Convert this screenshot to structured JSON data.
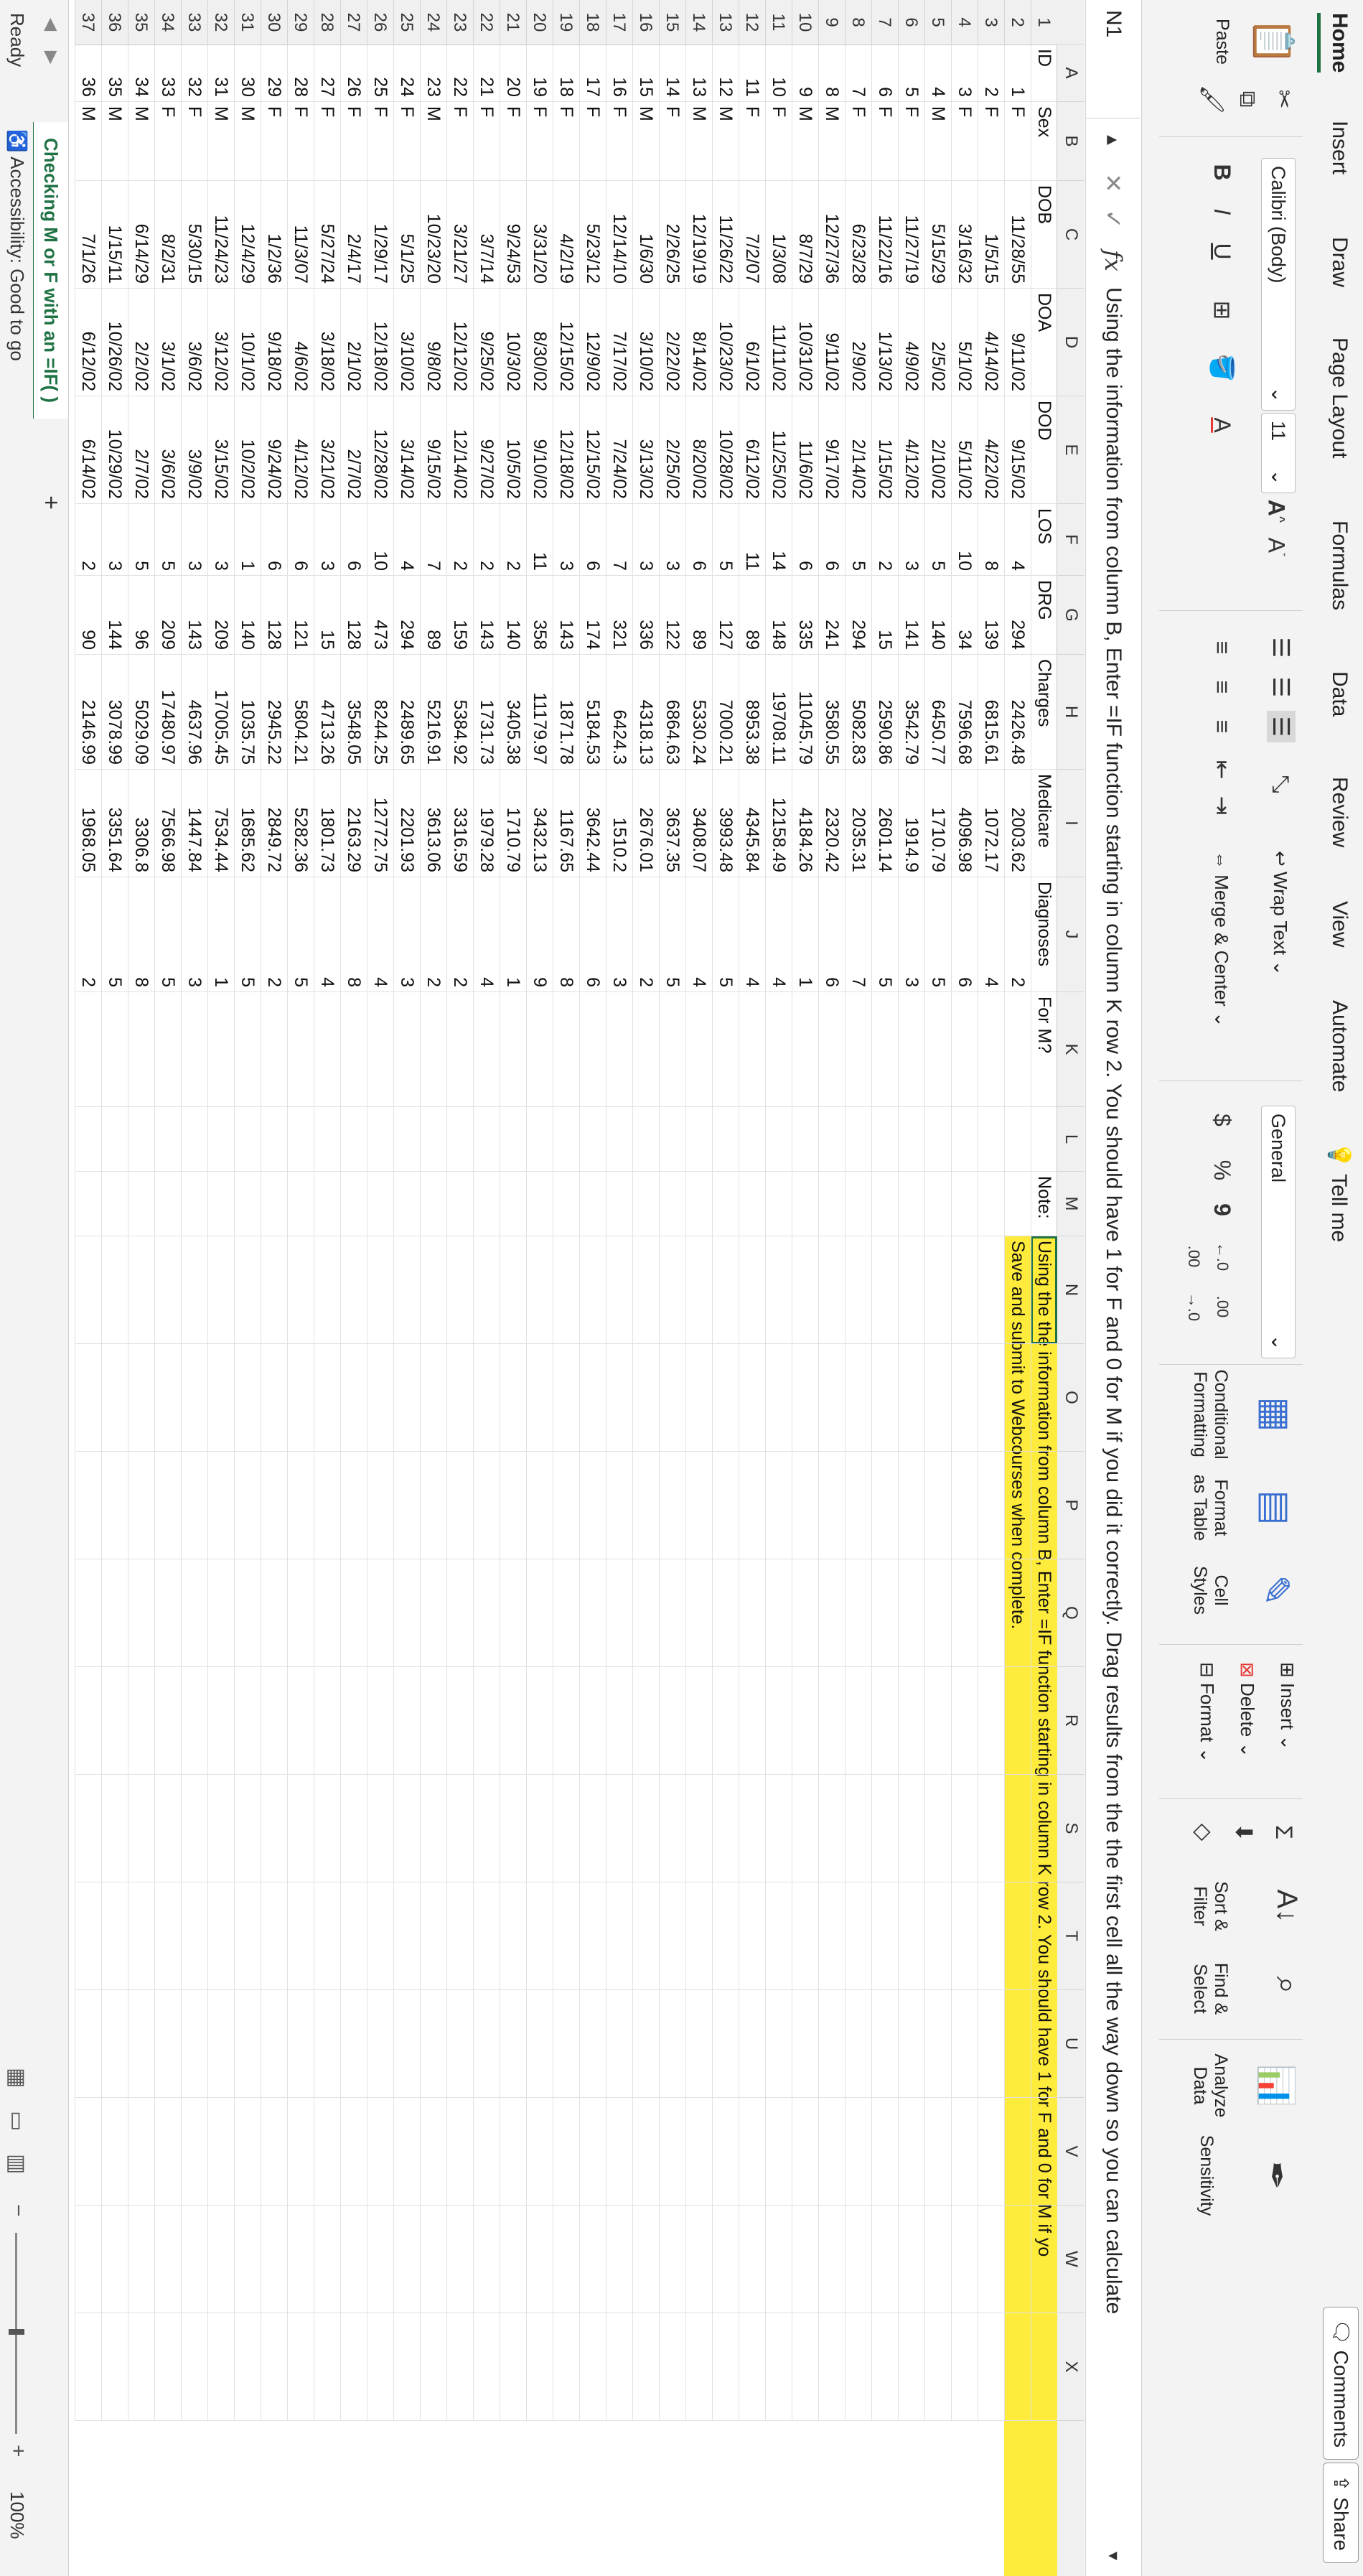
{
  "menu": [
    "Home",
    "Insert",
    "Draw",
    "Page Layout",
    "Formulas",
    "Data",
    "Review",
    "View",
    "Automate"
  ],
  "tell_me": "Tell me",
  "comments": "Comments",
  "share": "Share",
  "ribbon": {
    "paste": "Paste",
    "font_name": "Calibri (Body)",
    "font_size": "11",
    "bold": "B",
    "italic": "I",
    "underline": "U",
    "wrap_text": "Wrap Text",
    "merge_center": "Merge & Center",
    "number_format": "General",
    "currency": "$",
    "percent": "%",
    "comma": "9",
    "conditional_formatting": "Conditional Formatting",
    "format_as_table": "Format as Table",
    "cell_styles": "Cell Styles",
    "insert": "Insert",
    "delete": "Delete",
    "format": "Format",
    "sort_filter": "Sort & Filter",
    "find_select": "Find & Select",
    "analyze_data": "Analyze Data",
    "sensitivity": "Sensitivity"
  },
  "formula_bar": {
    "name_box": "N1",
    "fx": "fx",
    "formula": "Using the information from column B, Enter =IF function starting in column K row 2. You should have 1 for F and 0 for M if you did it correctly. Drag results from the the first cell all the way down so you can calculate"
  },
  "columns": [
    "A",
    "B",
    "C",
    "D",
    "E",
    "F",
    "G",
    "H",
    "I",
    "J",
    "K",
    "L",
    "M",
    "N",
    "O",
    "P",
    "Q",
    "R",
    "S",
    "T",
    "U",
    "V",
    "W",
    "X"
  ],
  "headers": [
    "ID",
    "Sex",
    "DOB",
    "DOA",
    "DOD",
    "LOS",
    "DRG",
    "Charges",
    "Medicare",
    "Diagnoses",
    "For M?",
    "",
    "Note:"
  ],
  "rows": [
    [
      "1",
      "F",
      "11/28/55",
      "9/11/02",
      "9/15/02",
      "4",
      "294",
      "2426.48",
      "2003.62",
      "2"
    ],
    [
      "2",
      "F",
      "1/5/15",
      "4/14/02",
      "4/22/02",
      "8",
      "139",
      "6815.61",
      "1072.17",
      "4"
    ],
    [
      "3",
      "F",
      "3/16/32",
      "5/1/02",
      "5/11/02",
      "10",
      "34",
      "7596.68",
      "4096.98",
      "6"
    ],
    [
      "4",
      "M",
      "5/15/29",
      "2/5/02",
      "2/10/02",
      "5",
      "140",
      "6450.77",
      "1710.79",
      "5"
    ],
    [
      "5",
      "F",
      "11/27/19",
      "4/9/02",
      "4/12/02",
      "3",
      "141",
      "3542.79",
      "1914.9",
      "3"
    ],
    [
      "6",
      "F",
      "11/22/16",
      "1/13/02",
      "1/15/02",
      "2",
      "15",
      "2590.86",
      "2601.14",
      "5"
    ],
    [
      "7",
      "F",
      "6/23/28",
      "2/9/02",
      "2/14/02",
      "5",
      "294",
      "5082.83",
      "2035.31",
      "7"
    ],
    [
      "8",
      "M",
      "12/27/36",
      "9/11/02",
      "9/17/02",
      "6",
      "241",
      "3580.55",
      "2320.42",
      "6"
    ],
    [
      "9",
      "M",
      "8/7/29",
      "10/31/02",
      "11/6/02",
      "6",
      "335",
      "11045.79",
      "4184.26",
      "1"
    ],
    [
      "10",
      "F",
      "1/3/08",
      "11/11/02",
      "11/25/02",
      "14",
      "148",
      "19708.11",
      "12158.49",
      "4"
    ],
    [
      "11",
      "F",
      "7/2/07",
      "6/1/02",
      "6/12/02",
      "11",
      "89",
      "8953.38",
      "4345.84",
      "4"
    ],
    [
      "12",
      "M",
      "11/26/22",
      "10/23/02",
      "10/28/02",
      "5",
      "127",
      "7000.21",
      "3993.48",
      "5"
    ],
    [
      "13",
      "M",
      "12/19/19",
      "8/14/02",
      "8/20/02",
      "6",
      "89",
      "5330.24",
      "3408.07",
      "4"
    ],
    [
      "14",
      "F",
      "2/26/25",
      "2/22/02",
      "2/25/02",
      "3",
      "122",
      "6864.63",
      "3637.35",
      "5"
    ],
    [
      "15",
      "M",
      "1/6/30",
      "3/10/02",
      "3/13/02",
      "3",
      "336",
      "4318.13",
      "2676.01",
      "2"
    ],
    [
      "16",
      "F",
      "12/14/10",
      "7/17/02",
      "7/24/02",
      "7",
      "321",
      "6424.3",
      "1510.2",
      "3"
    ],
    [
      "17",
      "F",
      "5/23/12",
      "12/9/02",
      "12/15/02",
      "6",
      "174",
      "5184.53",
      "3642.44",
      "6"
    ],
    [
      "18",
      "F",
      "4/2/19",
      "12/15/02",
      "12/18/02",
      "3",
      "143",
      "1871.78",
      "1167.65",
      "8"
    ],
    [
      "19",
      "F",
      "3/31/20",
      "8/30/02",
      "9/10/02",
      "11",
      "358",
      "11179.97",
      "3432.13",
      "9"
    ],
    [
      "20",
      "F",
      "9/24/53",
      "10/3/02",
      "10/5/02",
      "2",
      "140",
      "3405.38",
      "1710.79",
      "1"
    ],
    [
      "21",
      "F",
      "3/7/14",
      "9/25/02",
      "9/27/02",
      "2",
      "143",
      "1731.73",
      "1979.28",
      "4"
    ],
    [
      "22",
      "F",
      "3/21/27",
      "12/12/02",
      "12/14/02",
      "2",
      "159",
      "5384.92",
      "3316.59",
      "2"
    ],
    [
      "23",
      "M",
      "10/23/20",
      "9/8/02",
      "9/15/02",
      "7",
      "89",
      "5216.91",
      "3613.06",
      "2"
    ],
    [
      "24",
      "F",
      "5/1/25",
      "3/10/02",
      "3/14/02",
      "4",
      "294",
      "2489.65",
      "2201.93",
      "3"
    ],
    [
      "25",
      "F",
      "1/29/17",
      "12/18/02",
      "12/28/02",
      "10",
      "473",
      "8244.25",
      "12772.75",
      "4"
    ],
    [
      "26",
      "F",
      "2/4/17",
      "2/1/02",
      "2/7/02",
      "6",
      "128",
      "3548.05",
      "2163.29",
      "8"
    ],
    [
      "27",
      "F",
      "5/27/24",
      "3/18/02",
      "3/21/02",
      "3",
      "15",
      "4713.26",
      "1801.73",
      "4"
    ],
    [
      "28",
      "F",
      "11/3/07",
      "4/6/02",
      "4/12/02",
      "6",
      "121",
      "5804.21",
      "5282.36",
      "5"
    ],
    [
      "29",
      "F",
      "1/2/36",
      "9/18/02",
      "9/24/02",
      "6",
      "128",
      "2945.22",
      "2849.72",
      "2"
    ],
    [
      "30",
      "M",
      "12/4/29",
      "10/1/02",
      "10/2/02",
      "1",
      "140",
      "1035.75",
      "1685.62",
      "5"
    ],
    [
      "31",
      "M",
      "11/24/23",
      "3/12/02",
      "3/15/02",
      "3",
      "209",
      "17005.45",
      "7534.44",
      "1"
    ],
    [
      "32",
      "F",
      "5/30/15",
      "3/6/02",
      "3/9/02",
      "3",
      "143",
      "4637.96",
      "1447.84",
      "3"
    ],
    [
      "33",
      "F",
      "8/2/31",
      "3/1/02",
      "3/6/02",
      "5",
      "209",
      "17480.97",
      "7566.98",
      "5"
    ],
    [
      "34",
      "M",
      "6/14/29",
      "2/2/02",
      "2/7/02",
      "5",
      "96",
      "5029.09",
      "3306.8",
      "8"
    ],
    [
      "35",
      "M",
      "1/15/11",
      "10/26/02",
      "10/29/02",
      "3",
      "144",
      "3078.99",
      "3351.64",
      "5"
    ],
    [
      "36",
      "M",
      "7/1/26",
      "6/12/02",
      "6/14/02",
      "2",
      "90",
      "2146.99",
      "1968.05",
      "2"
    ]
  ],
  "note": {
    "line1": "Using the the information from column B, Enter =IF function starting in column K row 2. You should have 1 for F and 0 for M if yo",
    "line2": "Save and submit to Webcourses when complete."
  },
  "sheet_tab": "Checking M or F with an =IF( )",
  "add_sheet": "+",
  "status": {
    "ready": "Ready",
    "accessibility": "Accessibility: Good to go",
    "zoom": "100%"
  },
  "colors": {
    "accent": "#1f7244",
    "highlight": "#ffeb3b"
  }
}
